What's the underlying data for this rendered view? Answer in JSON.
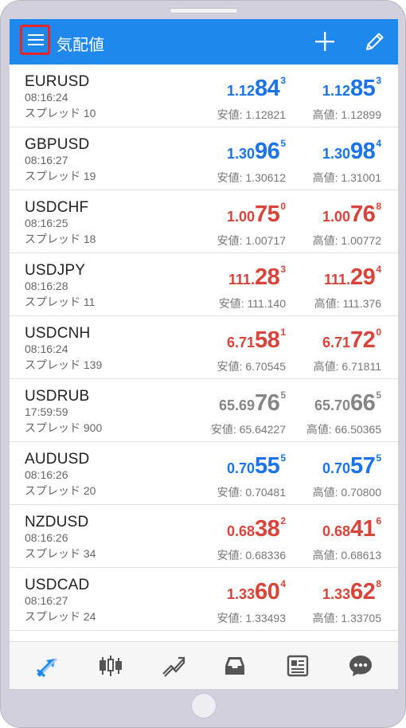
{
  "appbar": {
    "title": "気配値",
    "menu_icon": "hamburger-menu-icon",
    "add_icon": "plus-icon",
    "edit_icon": "pencil-icon"
  },
  "colors": {
    "primary": "#1e88ec",
    "up": "#1a73e8",
    "down": "#d9443a",
    "stale": "#868686",
    "highlight": "#e8262a"
  },
  "quotes": [
    {
      "symbol": "EURUSD",
      "time": "08:16:24",
      "spread": "スプレッド 10",
      "color": "blue",
      "bid": {
        "small": "1.12",
        "big": "84",
        "sup": "3"
      },
      "ask": {
        "small": "1.12",
        "big": "85",
        "sup": "3"
      },
      "low": "安値: 1.12821",
      "high": "高値: 1.12899"
    },
    {
      "symbol": "GBPUSD",
      "time": "08:16:27",
      "spread": "スプレッド 19",
      "color": "blue",
      "bid": {
        "small": "1.30",
        "big": "96",
        "sup": "5"
      },
      "ask": {
        "small": "1.30",
        "big": "98",
        "sup": "4"
      },
      "low": "安値: 1.30612",
      "high": "高値: 1.31001"
    },
    {
      "symbol": "USDCHF",
      "time": "08:16:25",
      "spread": "スプレッド 18",
      "color": "red",
      "bid": {
        "small": "1.00",
        "big": "75",
        "sup": "0"
      },
      "ask": {
        "small": "1.00",
        "big": "76",
        "sup": "8"
      },
      "low": "安値: 1.00717",
      "high": "高値: 1.00772"
    },
    {
      "symbol": "USDJPY",
      "time": "08:16:28",
      "spread": "スプレッド 11",
      "color": "red",
      "bid": {
        "small": "111.",
        "big": "28",
        "sup": "3"
      },
      "ask": {
        "small": "111.",
        "big": "29",
        "sup": "4"
      },
      "low": "安値: 111.140",
      "high": "高値: 111.376"
    },
    {
      "symbol": "USDCNH",
      "time": "08:16:24",
      "spread": "スプレッド 139",
      "color": "red",
      "bid": {
        "small": "6.71",
        "big": "58",
        "sup": "1"
      },
      "ask": {
        "small": "6.71",
        "big": "72",
        "sup": "0"
      },
      "low": "安値: 6.70545",
      "high": "高値: 6.71811"
    },
    {
      "symbol": "USDRUB",
      "time": "17:59:59",
      "spread": "スプレッド 900",
      "color": "gray",
      "bid": {
        "small": "65.69",
        "big": "76",
        "sup": "5"
      },
      "ask": {
        "small": "65.70",
        "big": "66",
        "sup": "5"
      },
      "low": "安値: 65.64227",
      "high": "高値: 66.50365"
    },
    {
      "symbol": "AUDUSD",
      "time": "08:16:26",
      "spread": "スプレッド 20",
      "color": "blue",
      "bid": {
        "small": "0.70",
        "big": "55",
        "sup": "5"
      },
      "ask": {
        "small": "0.70",
        "big": "57",
        "sup": "5"
      },
      "low": "安値: 0.70481",
      "high": "高値: 0.70800"
    },
    {
      "symbol": "NZDUSD",
      "time": "08:16:26",
      "spread": "スプレッド 34",
      "color": "red",
      "bid": {
        "small": "0.68",
        "big": "38",
        "sup": "2"
      },
      "ask": {
        "small": "0.68",
        "big": "41",
        "sup": "6"
      },
      "low": "安値: 0.68336",
      "high": "高値: 0.68613"
    },
    {
      "symbol": "USDCAD",
      "time": "08:16:27",
      "spread": "スプレッド 24",
      "color": "red",
      "bid": {
        "small": "1.33",
        "big": "60",
        "sup": "4"
      },
      "ask": {
        "small": "1.33",
        "big": "62",
        "sup": "8"
      },
      "low": "安値: 1.33493",
      "high": "高値: 1.33705"
    }
  ],
  "bottom_nav": {
    "items": [
      {
        "icon": "quotes-arrows-icon",
        "active": true
      },
      {
        "icon": "candlestick-chart-icon",
        "active": false
      },
      {
        "icon": "trade-trend-icon",
        "active": false
      },
      {
        "icon": "history-tray-icon",
        "active": false
      },
      {
        "icon": "news-icon",
        "active": false
      },
      {
        "icon": "chat-icon",
        "active": false
      }
    ]
  }
}
